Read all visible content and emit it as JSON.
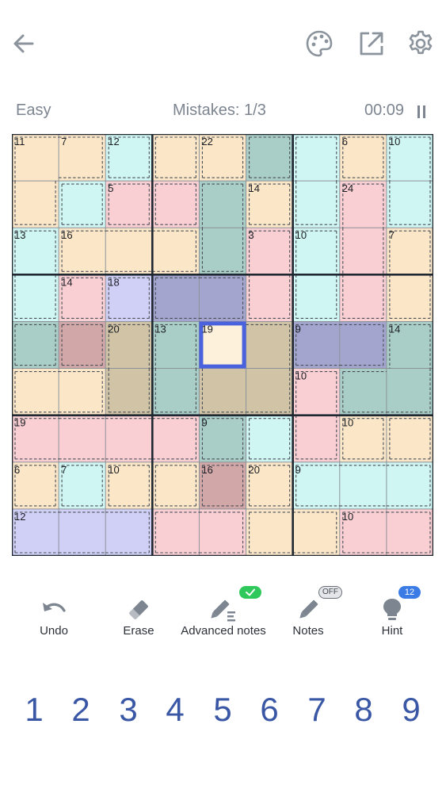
{
  "header": {
    "icons": [
      "back-arrow-icon",
      "palette-icon",
      "share-icon",
      "gear-icon"
    ]
  },
  "status": {
    "difficulty": "Easy",
    "mistakes": "Mistakes: 1/3",
    "timer": "00:09"
  },
  "board": {
    "regions": [
      "AABCDEFGH",
      "ABIJEKFLH",
      "MNNNEOPLQ",
      "MRSTTOPLQ",
      "UVWXYYZZ1",
      "22WXYYa11",
      "bbbbcdaef",
      "ghijklmmm",
      "nnnooppqq"
    ],
    "colors": {
      "A": "#fbe7c8",
      "B": "#cff6f2",
      "C": "#fbe7c8",
      "D": "#fbe7c8",
      "E": "#a9cdc7",
      "F": "#cff6f2",
      "G": "#fbe7c8",
      "H": "#cff6f2",
      "I": "#f9cfd3",
      "J": "#f9cfd3",
      "K": "#fbe7c8",
      "L": "#f9cfd3",
      "M": "#cff6f2",
      "N": "#fbe7c8",
      "O": "#f9cfd3",
      "P": "#cff6f2",
      "Q": "#fbe7c8",
      "R": "#f9cfd3",
      "S": "#d0d0f7",
      "T": "#a3a5cf",
      "U": "#a9cdc7",
      "V": "#d2a7a8",
      "W": "#d0c3a6",
      "X": "#a9cdc7",
      "Y": "#d0c3a6",
      "Z": "#a3a5cf",
      "1": "#a9cdc7",
      "2": "#fbe7c8",
      "a": "#f9cfd3",
      "b": "#f9cfd3",
      "c": "#a9cdc7",
      "d": "#cff6f2",
      "e": "#fbe7c8",
      "f": "#fbe7c8",
      "g": "#fbe7c8",
      "h": "#cff6f2",
      "i": "#fbe7c8",
      "j": "#fbe7c8",
      "k": "#d2a7a8",
      "l": "#fbe7c8",
      "m": "#cff6f2",
      "n": "#d0d0f7",
      "o": "#f9cfd3",
      "p": "#fbe7c8",
      "q": "#f9cfd3"
    },
    "cage_sums": [
      {
        "r": 0,
        "c": 0,
        "v": "11"
      },
      {
        "r": 0,
        "c": 1,
        "v": "7"
      },
      {
        "r": 0,
        "c": 2,
        "v": "12"
      },
      {
        "r": 0,
        "c": 4,
        "v": "22"
      },
      {
        "r": 0,
        "c": 7,
        "v": "6"
      },
      {
        "r": 0,
        "c": 8,
        "v": "10"
      },
      {
        "r": 1,
        "c": 2,
        "v": "5"
      },
      {
        "r": 1,
        "c": 5,
        "v": "14"
      },
      {
        "r": 1,
        "c": 7,
        "v": "24"
      },
      {
        "r": 2,
        "c": 0,
        "v": "13"
      },
      {
        "r": 2,
        "c": 1,
        "v": "16"
      },
      {
        "r": 2,
        "c": 5,
        "v": "3"
      },
      {
        "r": 2,
        "c": 6,
        "v": "10"
      },
      {
        "r": 2,
        "c": 8,
        "v": "7"
      },
      {
        "r": 3,
        "c": 1,
        "v": "14"
      },
      {
        "r": 3,
        "c": 2,
        "v": "18"
      },
      {
        "r": 4,
        "c": 2,
        "v": "20"
      },
      {
        "r": 4,
        "c": 3,
        "v": "13"
      },
      {
        "r": 4,
        "c": 4,
        "v": "19"
      },
      {
        "r": 4,
        "c": 6,
        "v": "9"
      },
      {
        "r": 4,
        "c": 8,
        "v": "14"
      },
      {
        "r": 5,
        "c": 6,
        "v": "10"
      },
      {
        "r": 6,
        "c": 0,
        "v": "19"
      },
      {
        "r": 6,
        "c": 4,
        "v": "9"
      },
      {
        "r": 6,
        "c": 7,
        "v": "10"
      },
      {
        "r": 7,
        "c": 0,
        "v": "6"
      },
      {
        "r": 7,
        "c": 1,
        "v": "7"
      },
      {
        "r": 7,
        "c": 2,
        "v": "10"
      },
      {
        "r": 7,
        "c": 4,
        "v": "16"
      },
      {
        "r": 7,
        "c": 5,
        "v": "20"
      },
      {
        "r": 7,
        "c": 6,
        "v": "9"
      },
      {
        "r": 8,
        "c": 0,
        "v": "12"
      },
      {
        "r": 8,
        "c": 7,
        "v": "10"
      }
    ],
    "selected": {
      "r": 4,
      "c": 4
    },
    "selected_fill": "#fdf1dc",
    "selected_border": "#4a62de"
  },
  "tools": [
    {
      "id": "undo",
      "label": "Undo",
      "icon": "undo-icon"
    },
    {
      "id": "erase",
      "label": "Erase",
      "icon": "eraser-icon"
    },
    {
      "id": "advanced-notes",
      "label": "Advanced notes",
      "icon": "advanced-notes-icon",
      "badge": "check"
    },
    {
      "id": "notes",
      "label": "Notes",
      "icon": "pencil-icon",
      "badge": "OFF"
    },
    {
      "id": "hint",
      "label": "Hint",
      "icon": "lightbulb-icon",
      "badge": "12"
    }
  ],
  "numbers": [
    "1",
    "2",
    "3",
    "4",
    "5",
    "6",
    "7",
    "8",
    "9"
  ]
}
